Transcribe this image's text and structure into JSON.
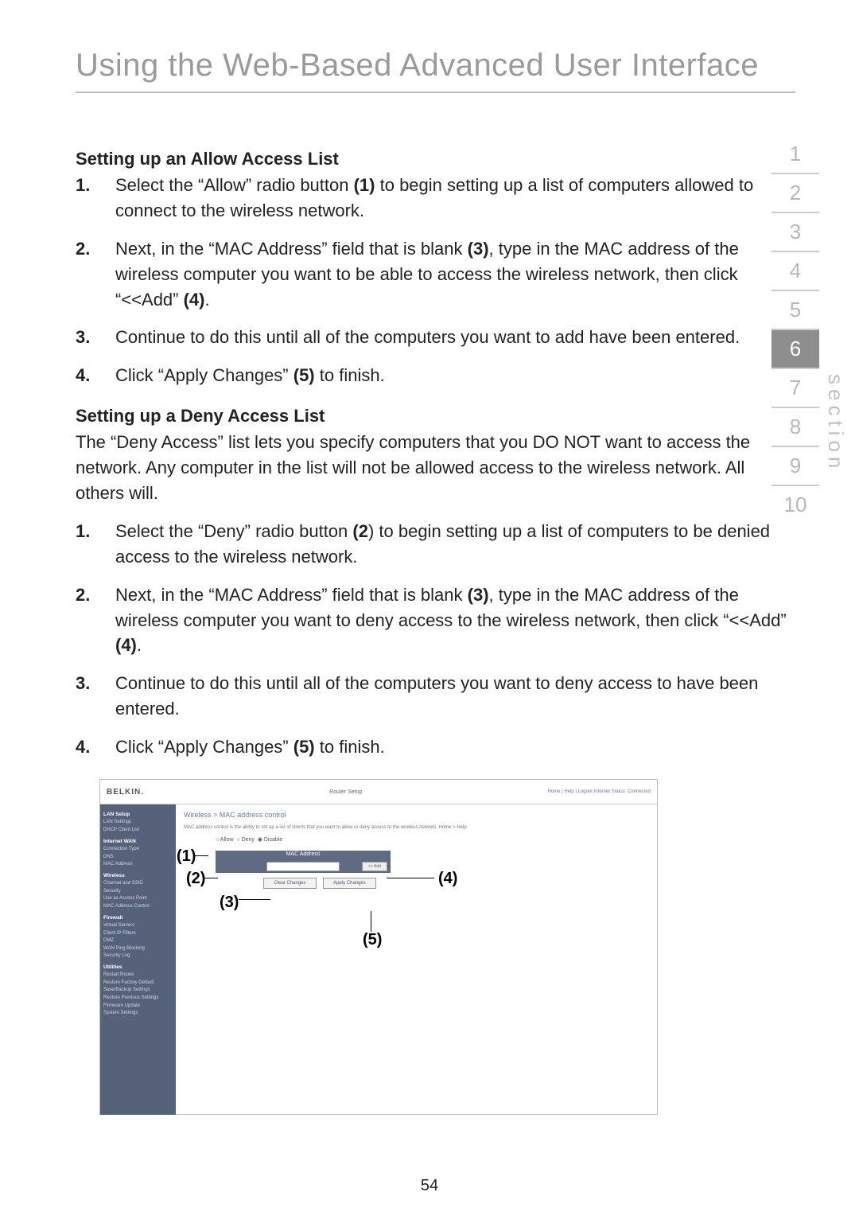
{
  "title": "Using the Web-Based Advanced User Interface",
  "page_number": "54",
  "side_label": "section",
  "sections": [
    "1",
    "2",
    "3",
    "4",
    "5",
    "6",
    "7",
    "8",
    "9",
    "10"
  ],
  "active_section_index": 5,
  "allow": {
    "heading": "Setting up an Allow Access List",
    "s1a": "Select the “Allow” radio button ",
    "s1b": "(1)",
    "s1c": " to begin setting up a list of computers allowed to connect to the wireless network.",
    "s2a": "Next, in the “MAC Address” field that is blank ",
    "s2b": "(3)",
    "s2c": ", type in the MAC address of the wireless computer you want to be able to access the wireless network, then click “<<Add” ",
    "s2d": "(4)",
    "s2e": ".",
    "s3": "Continue to do this until all of the computers you want to add have been entered.",
    "s4a": "Click “Apply Changes” ",
    "s4b": "(5)",
    "s4c": " to finish."
  },
  "deny": {
    "heading": "Setting up a Deny Access List",
    "intro": "The “Deny Access” list lets you specify computers that you DO NOT want to access the network. Any computer in the list will not be allowed access to the wireless network. All others will.",
    "s1a": "Select the “Deny” radio button ",
    "s1b": "(2",
    "s1c": ") to begin setting up a list of computers to be denied access to the wireless network.",
    "s2a": "Next, in the “MAC Address” field that is blank ",
    "s2b": "(3)",
    "s2c": ", type in the MAC address of the wireless computer you want to deny access to the wireless network, then click “<<Add” ",
    "s2d": "(4)",
    "s2e": ".",
    "s3": "Continue to do this until all of the computers you want to deny access to have been entered.",
    "s4a": "Click “Apply Changes” ",
    "s4b": "(5)",
    "s4c": " to finish."
  },
  "shot": {
    "brand": "BELKIN.",
    "setup": "Router Setup",
    "status": "Home | Help | Logout    Internet Status: Connected",
    "bc": "Wireless > MAC address control",
    "desc": "MAC address control is the ability to set up a list of clients that you want to allow or deny access to the wireless network.  Home > Help",
    "radio_allow": "Allow",
    "radio_deny": "Deny",
    "radio_disable": "Disable",
    "mac_hdr": "MAC Address",
    "add_btn": "<< Add",
    "btn_clear": "Clear Changes",
    "btn_apply": "Apply Changes",
    "nav": {
      "g1": "LAN Setup",
      "g1a": "LAN Settings",
      "g1b": "DHCP Client List",
      "g2": "Internet WAN",
      "g2a": "Connection Type",
      "g2b": "DNS",
      "g2c": "MAC Address",
      "g3": "Wireless",
      "g3a": "Channel and SSID",
      "g3b": "Security",
      "g3c": "Use as Access Point",
      "g3d": "MAC Address Control",
      "g4": "Firewall",
      "g4a": "Virtual Servers",
      "g4b": "Client IP Filters",
      "g4c": "DMZ",
      "g4d": "WAN Ping Blocking",
      "g4e": "Security Log",
      "g5": "Utilities",
      "g5a": "Restart Router",
      "g5b": "Restore Factory Default",
      "g5c": "Save/Backup Settings",
      "g5d": "Restore Previous Settings",
      "g5e": "Firmware Update",
      "g5f": "System Settings"
    },
    "ann": {
      "1": "(1)",
      "2": "(2)",
      "3": "(3)",
      "4": "(4)",
      "5": "(5)"
    }
  }
}
